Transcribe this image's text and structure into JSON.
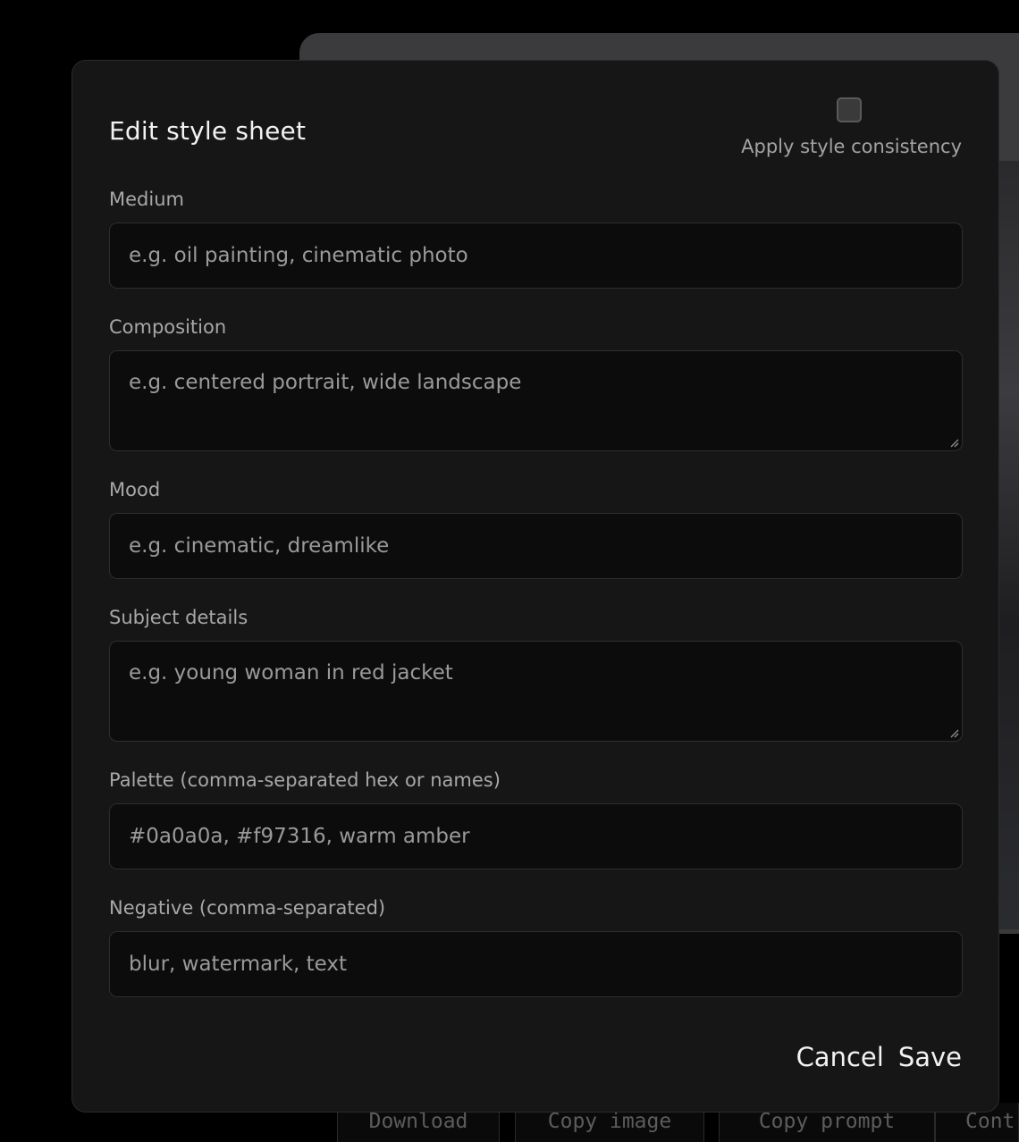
{
  "modal": {
    "title": "Edit style sheet",
    "consistency_label": "Apply style consistency",
    "consistency_checked": false,
    "fields": {
      "medium": {
        "label": "Medium",
        "placeholder": "e.g. oil painting, cinematic photo"
      },
      "composition": {
        "label": "Composition",
        "placeholder": "e.g. centered portrait, wide landscape"
      },
      "mood": {
        "label": "Mood",
        "placeholder": "e.g. cinematic, dreamlike"
      },
      "subject": {
        "label": "Subject details",
        "placeholder": "e.g. young woman in red jacket"
      },
      "palette": {
        "label": "Palette (comma-separated hex or names)",
        "placeholder": "#0a0a0a, #f97316, warm amber"
      },
      "negative": {
        "label": "Negative (comma-separated)",
        "placeholder": "blur, watermark, text"
      }
    },
    "cancel_label": "Cancel",
    "save_label": "Save"
  },
  "bottom_bar": {
    "download_label": "Download",
    "copy_image_label": "Copy image",
    "copy_prompt_label": "Copy prompt",
    "more_label": "Cont"
  }
}
